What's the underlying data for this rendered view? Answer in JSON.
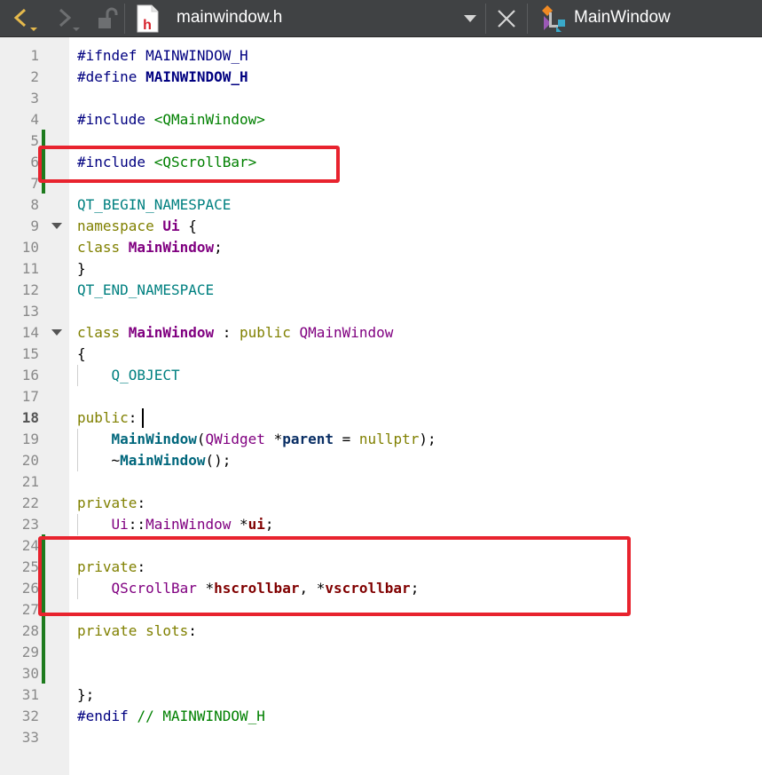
{
  "toolbar": {
    "file_name": "mainwindow.h",
    "file_icon_letter": "h",
    "symbol_name": "MainWindow",
    "icons": [
      "back-arrow-icon",
      "forward-arrow-icon",
      "lock-icon",
      "header-file-icon",
      "dropdown-arrow-icon",
      "close-icon",
      "class-icon"
    ]
  },
  "editor": {
    "current_line": 18,
    "lines": [
      {
        "n": "1",
        "tokens": [
          {
            "t": "#ifndef ",
            "c": "pre"
          },
          {
            "t": "MAINWINDOW_H",
            "c": "macro"
          }
        ]
      },
      {
        "n": "2",
        "tokens": [
          {
            "t": "#define ",
            "c": "pre"
          },
          {
            "t": "MAINWINDOW_H",
            "c": "macro-b"
          }
        ]
      },
      {
        "n": "3",
        "tokens": []
      },
      {
        "n": "4",
        "tokens": [
          {
            "t": "#include ",
            "c": "pre"
          },
          {
            "t": "<QMainWindow>",
            "c": "str"
          }
        ]
      },
      {
        "n": "5",
        "tokens": []
      },
      {
        "n": "6",
        "tokens": [
          {
            "t": "#include ",
            "c": "pre"
          },
          {
            "t": "<QScrollBar>",
            "c": "str"
          }
        ]
      },
      {
        "n": "7",
        "tokens": []
      },
      {
        "n": "8",
        "tokens": [
          {
            "t": "QT_BEGIN_NAMESPACE",
            "c": "ns"
          }
        ]
      },
      {
        "n": "9",
        "tokens": [
          {
            "t": "namespace ",
            "c": "kw"
          },
          {
            "t": "Ui",
            "c": "type-b"
          },
          {
            "t": " {",
            "c": "op"
          }
        ]
      },
      {
        "n": "10",
        "tokens": [
          {
            "t": "class ",
            "c": "kw"
          },
          {
            "t": "MainWindow",
            "c": "type-b"
          },
          {
            "t": ";",
            "c": "op"
          }
        ]
      },
      {
        "n": "11",
        "tokens": [
          {
            "t": "}",
            "c": "op"
          }
        ]
      },
      {
        "n": "12",
        "tokens": [
          {
            "t": "QT_END_NAMESPACE",
            "c": "ns"
          }
        ]
      },
      {
        "n": "13",
        "tokens": []
      },
      {
        "n": "14",
        "tokens": [
          {
            "t": "class ",
            "c": "kw"
          },
          {
            "t": "MainWindow",
            "c": "type-b"
          },
          {
            "t": " : ",
            "c": "op"
          },
          {
            "t": "public ",
            "c": "kw"
          },
          {
            "t": "QMainWindow",
            "c": "type"
          }
        ]
      },
      {
        "n": "15",
        "tokens": [
          {
            "t": "{",
            "c": "op"
          }
        ]
      },
      {
        "n": "16",
        "tokens": [
          {
            "t": "    ",
            "c": "op"
          },
          {
            "t": "Q_OBJECT",
            "c": "ns"
          }
        ]
      },
      {
        "n": "17",
        "tokens": []
      },
      {
        "n": "18",
        "tokens": [
          {
            "t": "public",
            "c": "kw"
          },
          {
            "t": ":",
            "c": "op"
          }
        ]
      },
      {
        "n": "19",
        "tokens": [
          {
            "t": "    ",
            "c": "op"
          },
          {
            "t": "MainWindow",
            "c": "fn-b"
          },
          {
            "t": "(",
            "c": "op"
          },
          {
            "t": "QWidget",
            "c": "type"
          },
          {
            "t": " *",
            "c": "op"
          },
          {
            "t": "parent",
            "c": "param-b"
          },
          {
            "t": " = ",
            "c": "op"
          },
          {
            "t": "nullptr",
            "c": "kw"
          },
          {
            "t": ");",
            "c": "op"
          }
        ]
      },
      {
        "n": "20",
        "tokens": [
          {
            "t": "    ~",
            "c": "op"
          },
          {
            "t": "MainWindow",
            "c": "fn-b"
          },
          {
            "t": "();",
            "c": "op"
          }
        ]
      },
      {
        "n": "21",
        "tokens": []
      },
      {
        "n": "22",
        "tokens": [
          {
            "t": "private",
            "c": "kw"
          },
          {
            "t": ":",
            "c": "op"
          }
        ]
      },
      {
        "n": "23",
        "tokens": [
          {
            "t": "    ",
            "c": "op"
          },
          {
            "t": "Ui",
            "c": "type"
          },
          {
            "t": "::",
            "c": "op"
          },
          {
            "t": "MainWindow",
            "c": "type"
          },
          {
            "t": " *",
            "c": "op"
          },
          {
            "t": "ui",
            "c": "field-b"
          },
          {
            "t": ";",
            "c": "op"
          }
        ]
      },
      {
        "n": "24",
        "tokens": []
      },
      {
        "n": "25",
        "tokens": [
          {
            "t": "private",
            "c": "kw"
          },
          {
            "t": ":",
            "c": "op"
          }
        ]
      },
      {
        "n": "26",
        "tokens": [
          {
            "t": "    ",
            "c": "op"
          },
          {
            "t": "QScrollBar",
            "c": "type"
          },
          {
            "t": " *",
            "c": "op"
          },
          {
            "t": "hscrollbar",
            "c": "field-b"
          },
          {
            "t": ", *",
            "c": "op"
          },
          {
            "t": "vscrollbar",
            "c": "field-b"
          },
          {
            "t": ";",
            "c": "op"
          }
        ]
      },
      {
        "n": "27",
        "tokens": []
      },
      {
        "n": "28",
        "tokens": [
          {
            "t": "private slots",
            "c": "kw"
          },
          {
            "t": ":",
            "c": "op"
          }
        ]
      },
      {
        "n": "29",
        "tokens": []
      },
      {
        "n": "30",
        "tokens": []
      },
      {
        "n": "31",
        "tokens": [
          {
            "t": "};",
            "c": "op"
          }
        ]
      },
      {
        "n": "32",
        "tokens": [
          {
            "t": "#endif ",
            "c": "pre"
          },
          {
            "t": "// MAINWINDOW_H",
            "c": "cmt"
          }
        ]
      },
      {
        "n": "33",
        "tokens": []
      }
    ],
    "foldable_lines": [
      9,
      14
    ]
  },
  "annotations": [
    "red-highlight-include",
    "red-highlight-private-members"
  ],
  "colors": {
    "toolbar_bg": "#404244",
    "gutter_bg": "#efefef",
    "change_marker": "#1e7b1e",
    "highlight_box": "#e8232e",
    "back_arrow": "#e5b94c"
  }
}
